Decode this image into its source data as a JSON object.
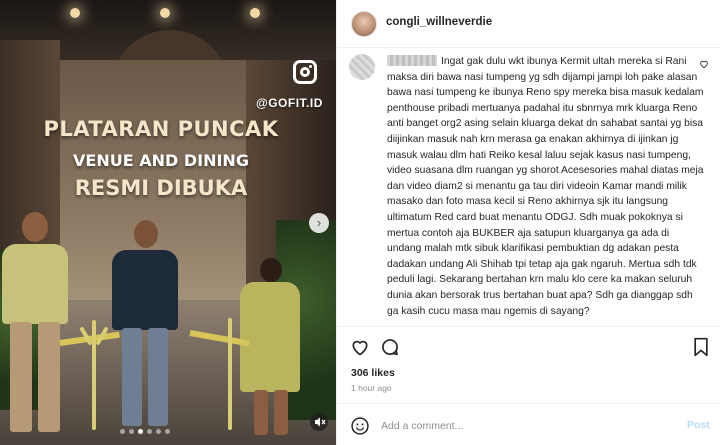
{
  "media": {
    "headline_line1": "PLATARAN PUNCAK",
    "headline_line2": "VENUE AND DINING",
    "headline_line3": "RESMI DIBUKA",
    "watermark": "@GOFIT.ID",
    "next_glyph": "›",
    "sound_glyph": "🔇",
    "carousel_dots": 6,
    "active_dot": 2
  },
  "post": {
    "username": "congli_willneverdie",
    "comment": "Ingat gak dulu wkt ibunya Kermit ultah mereka si Rani maksa diri bawa nasi tumpeng yg sdh dijampi jampi loh pake alasan bawa nasi tumpeng ke ibunya Reno spy mereka bisa masuk kedalam penthouse pribadi mertuanya padahal itu sbnrnya mrk kluarga Reno anti banget org2 asing selain kluarga dekat dn sahabat santai yg bisa diijinkan masuk nah krn merasa ga enakan akhirnya di ijinkan jg masuk walau dlm hati Reiko kesal laluu sejak kasus nasi tumpeng, video suasana dlm ruangan yg shorot Acesesories mahal diatas meja dan video diam2 si menantu ga tau diri videoin Kamar mandi milik masako dan foto masa kecil si Reno akhirnya sjk itu langsung ultimatum Red card buat menantu ODGJ. Sdh muak pokoknya si mertua contoh aja BUKBER aja satupun kluarganya ga ada di undang malah mtk sibuk klarifikasi pembuktian dg adakan pesta dadakan undang Ali Shihab tpi tetap aja gak ngaruh. Mertua sdh tdk peduli lagi. Sekarang bertahan krn malu klo cere ka makan seluruh dunia akan bersorak trus bertahan buat apa? Sdh ga dianggap sdh ga kasih cucu masa mau ngemis di sayang?",
    "more_glyph": "♡",
    "likes": "306 likes",
    "time": "1 hour ago",
    "add_comment_placeholder": "Add a comment...",
    "post_label": "Post"
  },
  "colors": {
    "accent_disabled": "#b2dffc",
    "text": "#262626",
    "muted": "#8e8e8e"
  },
  "icons": [
    "heart-icon",
    "comment-icon",
    "bookmark-icon",
    "emoji-icon",
    "instagram-icon"
  ]
}
